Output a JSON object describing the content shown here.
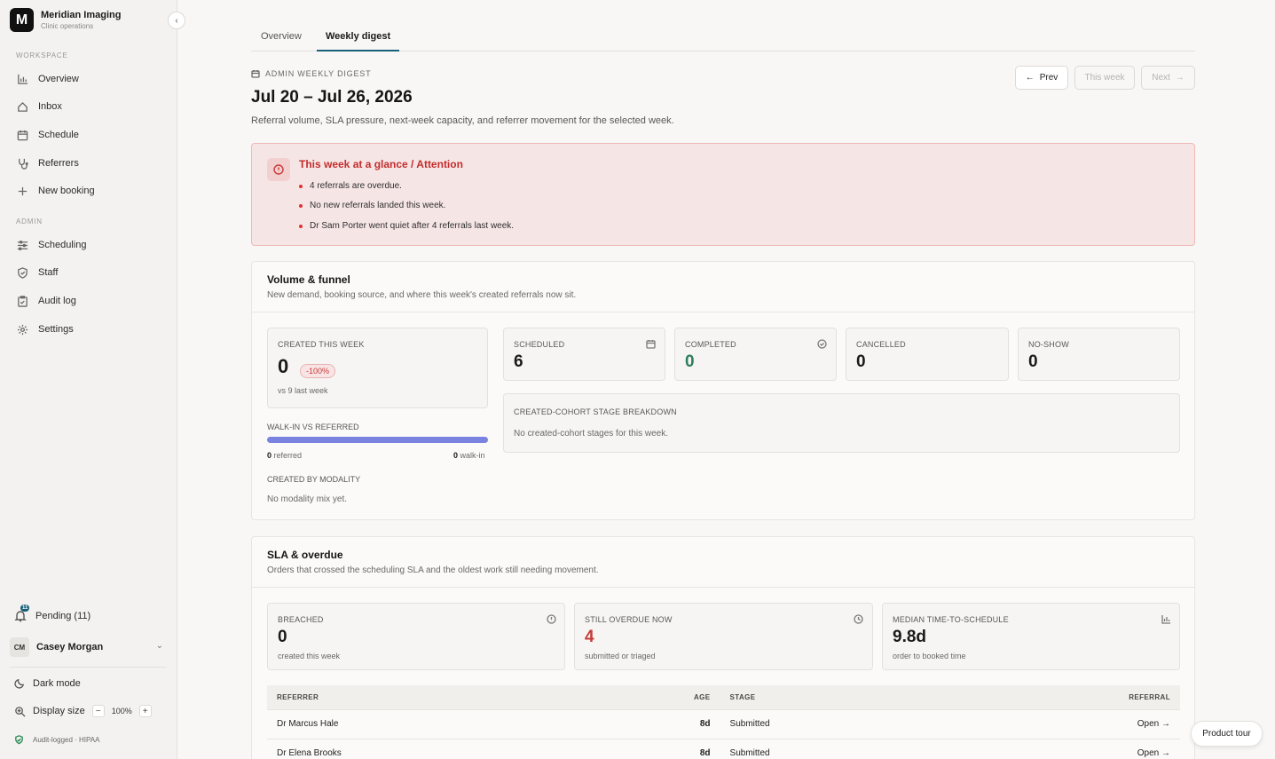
{
  "brand": {
    "logo_letter": "M",
    "name": "Meridian Imaging",
    "subtitle": "Clinic operations"
  },
  "sidebar": {
    "workspace_label": "WORKSPACE",
    "workspace_items": [
      {
        "label": "Overview",
        "icon": "bar-chart-icon"
      },
      {
        "label": "Inbox",
        "icon": "home-icon"
      },
      {
        "label": "Schedule",
        "icon": "calendar-icon"
      },
      {
        "label": "Referrers",
        "icon": "stethoscope-icon"
      },
      {
        "label": "New booking",
        "icon": "plus-icon"
      }
    ],
    "admin_label": "ADMIN",
    "admin_items": [
      {
        "label": "Scheduling",
        "icon": "sliders-icon"
      },
      {
        "label": "Staff",
        "icon": "shield-icon"
      },
      {
        "label": "Audit log",
        "icon": "clipboard-icon"
      },
      {
        "label": "Settings",
        "icon": "gear-icon"
      }
    ],
    "pending_label": "Pending (11)",
    "pending_badge": "11",
    "user_initials": "CM",
    "user_name": "Casey Morgan",
    "dark_mode_label": "Dark mode",
    "display_size_label": "Display size",
    "display_size_value": "100%",
    "minus": "−",
    "plus": "+",
    "audit_label": "Audit-logged · HIPAA"
  },
  "tabs": [
    {
      "label": "Overview",
      "active": false
    },
    {
      "label": "Weekly digest",
      "active": true
    }
  ],
  "header": {
    "eyebrow": "ADMIN WEEKLY DIGEST",
    "title": "Jul 20 – Jul 26, 2026",
    "description": "Referral volume, SLA pressure, next-week capacity, and referrer movement for the selected week.",
    "prev_label": "Prev",
    "this_week_label": "This week",
    "next_label": "Next"
  },
  "alert": {
    "title": "This week at a glance / Attention",
    "items": [
      "4 referrals are overdue.",
      "No new referrals landed this week.",
      "Dr Sam Porter went quiet after 4 referrals last week."
    ]
  },
  "volume": {
    "title": "Volume & funnel",
    "description": "New demand, booking source, and where this week's created referrals now sit.",
    "created_label": "CREATED THIS WEEK",
    "created_value": "0",
    "created_change": "-100%",
    "created_sub": "vs 9 last week",
    "walkin_label": "WALK-IN VS REFERRED",
    "referred_count": "0",
    "referred_text": "referred",
    "walkin_count": "0",
    "walkin_text": "walk-in",
    "modality_label": "CREATED BY MODALITY",
    "modality_empty": "No modality mix yet.",
    "stats": [
      {
        "label": "SCHEDULED",
        "value": "6",
        "icon": "calendar-icon",
        "color": "#1a1a1a"
      },
      {
        "label": "COMPLETED",
        "value": "0",
        "icon": "check-circle-icon",
        "color": "#2e7d5b"
      },
      {
        "label": "CANCELLED",
        "value": "0",
        "icon": "",
        "color": "#1a1a1a"
      },
      {
        "label": "NO-SHOW",
        "value": "0",
        "icon": "",
        "color": "#1a1a1a"
      }
    ],
    "breakdown_label": "CREATED-COHORT STAGE BREAKDOWN",
    "breakdown_empty": "No created-cohort stages for this week."
  },
  "sla": {
    "title": "SLA & overdue",
    "description": "Orders that crossed the scheduling SLA and the oldest work still needing movement.",
    "stats": [
      {
        "label": "BREACHED",
        "value": "0",
        "sub": "created this week",
        "icon": "alert-circle-icon",
        "color": "#1a1a1a"
      },
      {
        "label": "STILL OVERDUE NOW",
        "value": "4",
        "sub": "submitted or triaged",
        "icon": "clock-icon",
        "color": "#c83a3a"
      },
      {
        "label": "MEDIAN TIME-TO-SCHEDULE",
        "value": "9.8d",
        "sub": "order to booked time",
        "icon": "bar-chart-icon",
        "color": "#1a1a1a"
      }
    ],
    "table": {
      "headers": {
        "referrer": "REFERRER",
        "age": "AGE",
        "stage": "STAGE",
        "referral": "REFERRAL"
      },
      "rows": [
        {
          "referrer": "Dr Marcus Hale",
          "age": "8d",
          "stage": "Submitted",
          "action": "Open →"
        },
        {
          "referrer": "Dr Elena Brooks",
          "age": "8d",
          "stage": "Submitted",
          "action": "Open →"
        }
      ]
    }
  },
  "product_tour_label": "Product tour",
  "colors": {
    "accent": "#1a5f7a",
    "alert_red": "#c83a3a",
    "success": "#2e7d5b",
    "bar": "#7b83e0"
  }
}
